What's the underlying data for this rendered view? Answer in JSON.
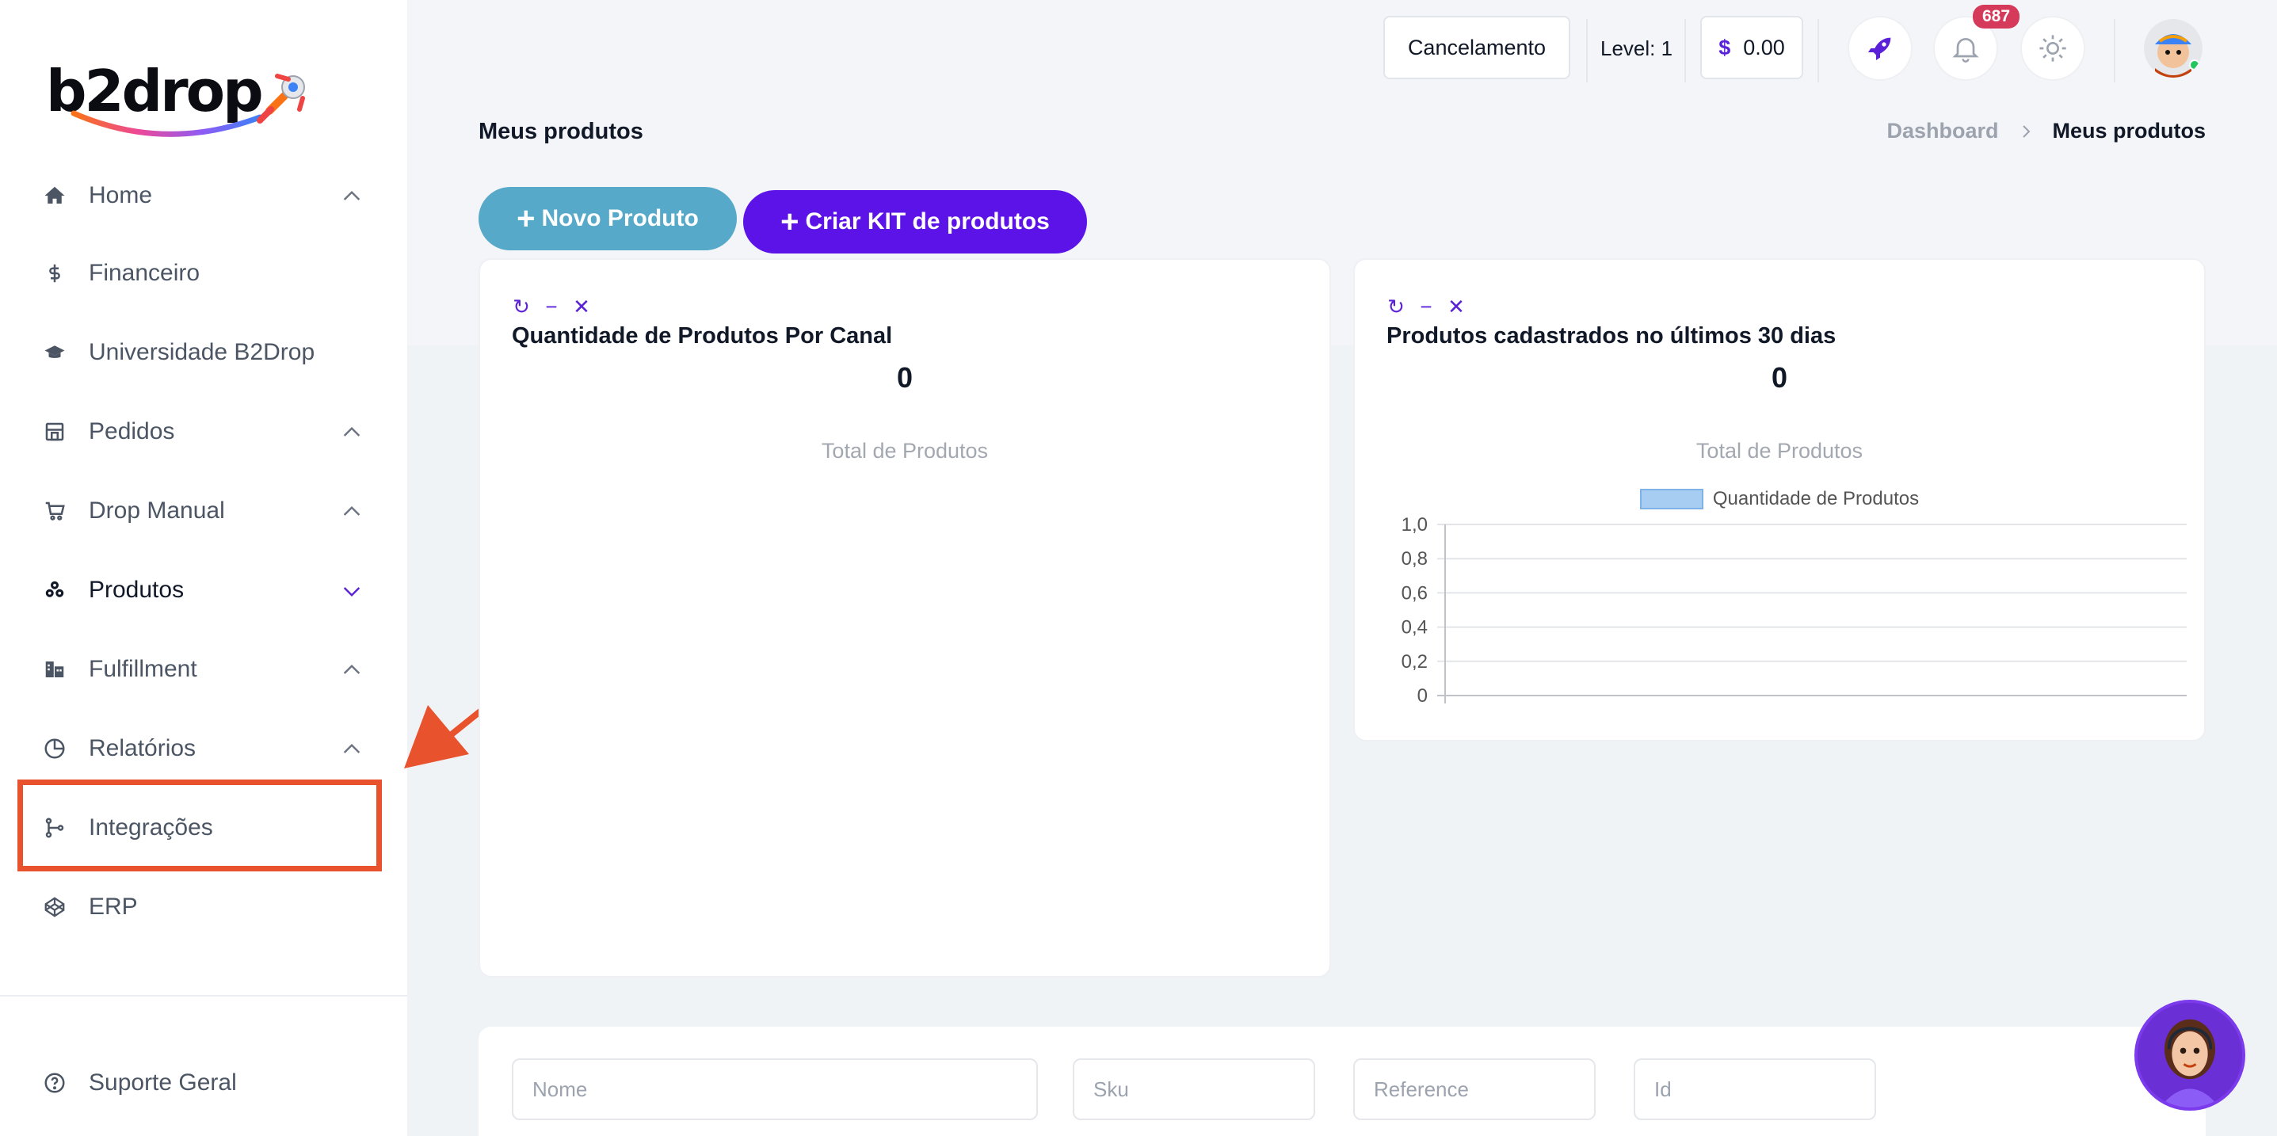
{
  "brand": {
    "name": "b2drop"
  },
  "sidebar": {
    "items": [
      {
        "label": "Home",
        "icon": "home-icon",
        "chevron": "up"
      },
      {
        "label": "Financeiro",
        "icon": "dollar-icon",
        "chevron": ""
      },
      {
        "label": "Universidade B2Drop",
        "icon": "graduation-cap-icon",
        "chevron": ""
      },
      {
        "label": "Pedidos",
        "icon": "store-icon",
        "chevron": "up"
      },
      {
        "label": "Drop Manual",
        "icon": "cart-icon",
        "chevron": "up"
      },
      {
        "label": "Produtos",
        "icon": "boxes-icon",
        "chevron": "down"
      },
      {
        "label": "Fulfillment",
        "icon": "warehouse-icon",
        "chevron": "up"
      },
      {
        "label": "Relatórios",
        "icon": "pie-chart-icon",
        "chevron": "up"
      },
      {
        "label": "Integrações",
        "icon": "git-branch-icon",
        "chevron": ""
      },
      {
        "label": "ERP",
        "icon": "codepen-icon",
        "chevron": ""
      }
    ],
    "support": {
      "label": "Suporte Geral",
      "icon": "help-circle-icon"
    }
  },
  "topbar": {
    "cancel_label": "Cancelamento",
    "level_label": "Level: 1",
    "balance_symbol": "$",
    "balance": "0.00",
    "notification_count": "687"
  },
  "page": {
    "title": "Meus produtos",
    "breadcrumb": {
      "home": "Dashboard",
      "current": "Meus produtos"
    }
  },
  "actions": {
    "new_product": "Novo Produto",
    "create_kit": "Criar KIT de produtos"
  },
  "cards": [
    {
      "title": "Quantidade de Produtos Por Canal",
      "value": "0",
      "subtitle": "Total de Produtos"
    },
    {
      "title": "Produtos cadastrados no últimos 30 dias",
      "value": "0",
      "subtitle": "Total de Produtos"
    }
  ],
  "chart_data": {
    "type": "bar",
    "categories": [],
    "series": [
      {
        "name": "Quantidade de Produtos",
        "values": []
      }
    ],
    "title": "",
    "xlabel": "",
    "ylabel": "",
    "ylim": [
      0,
      1
    ],
    "yticks": [
      "1,0",
      "0,8",
      "0,6",
      "0,4",
      "0,2",
      "0"
    ],
    "grid": true,
    "legend": "top-center",
    "colors": {
      "fill": "#a8cdf2",
      "border": "#7fb2e6"
    }
  },
  "filters": {
    "nome": "Nome",
    "sku": "Sku",
    "reference": "Reference",
    "id": "Id"
  },
  "colors": {
    "accent": "#5b21d9",
    "new_product_button": "#56a9c9",
    "annotation": "#e8522c",
    "badge": "#d63a5a"
  }
}
